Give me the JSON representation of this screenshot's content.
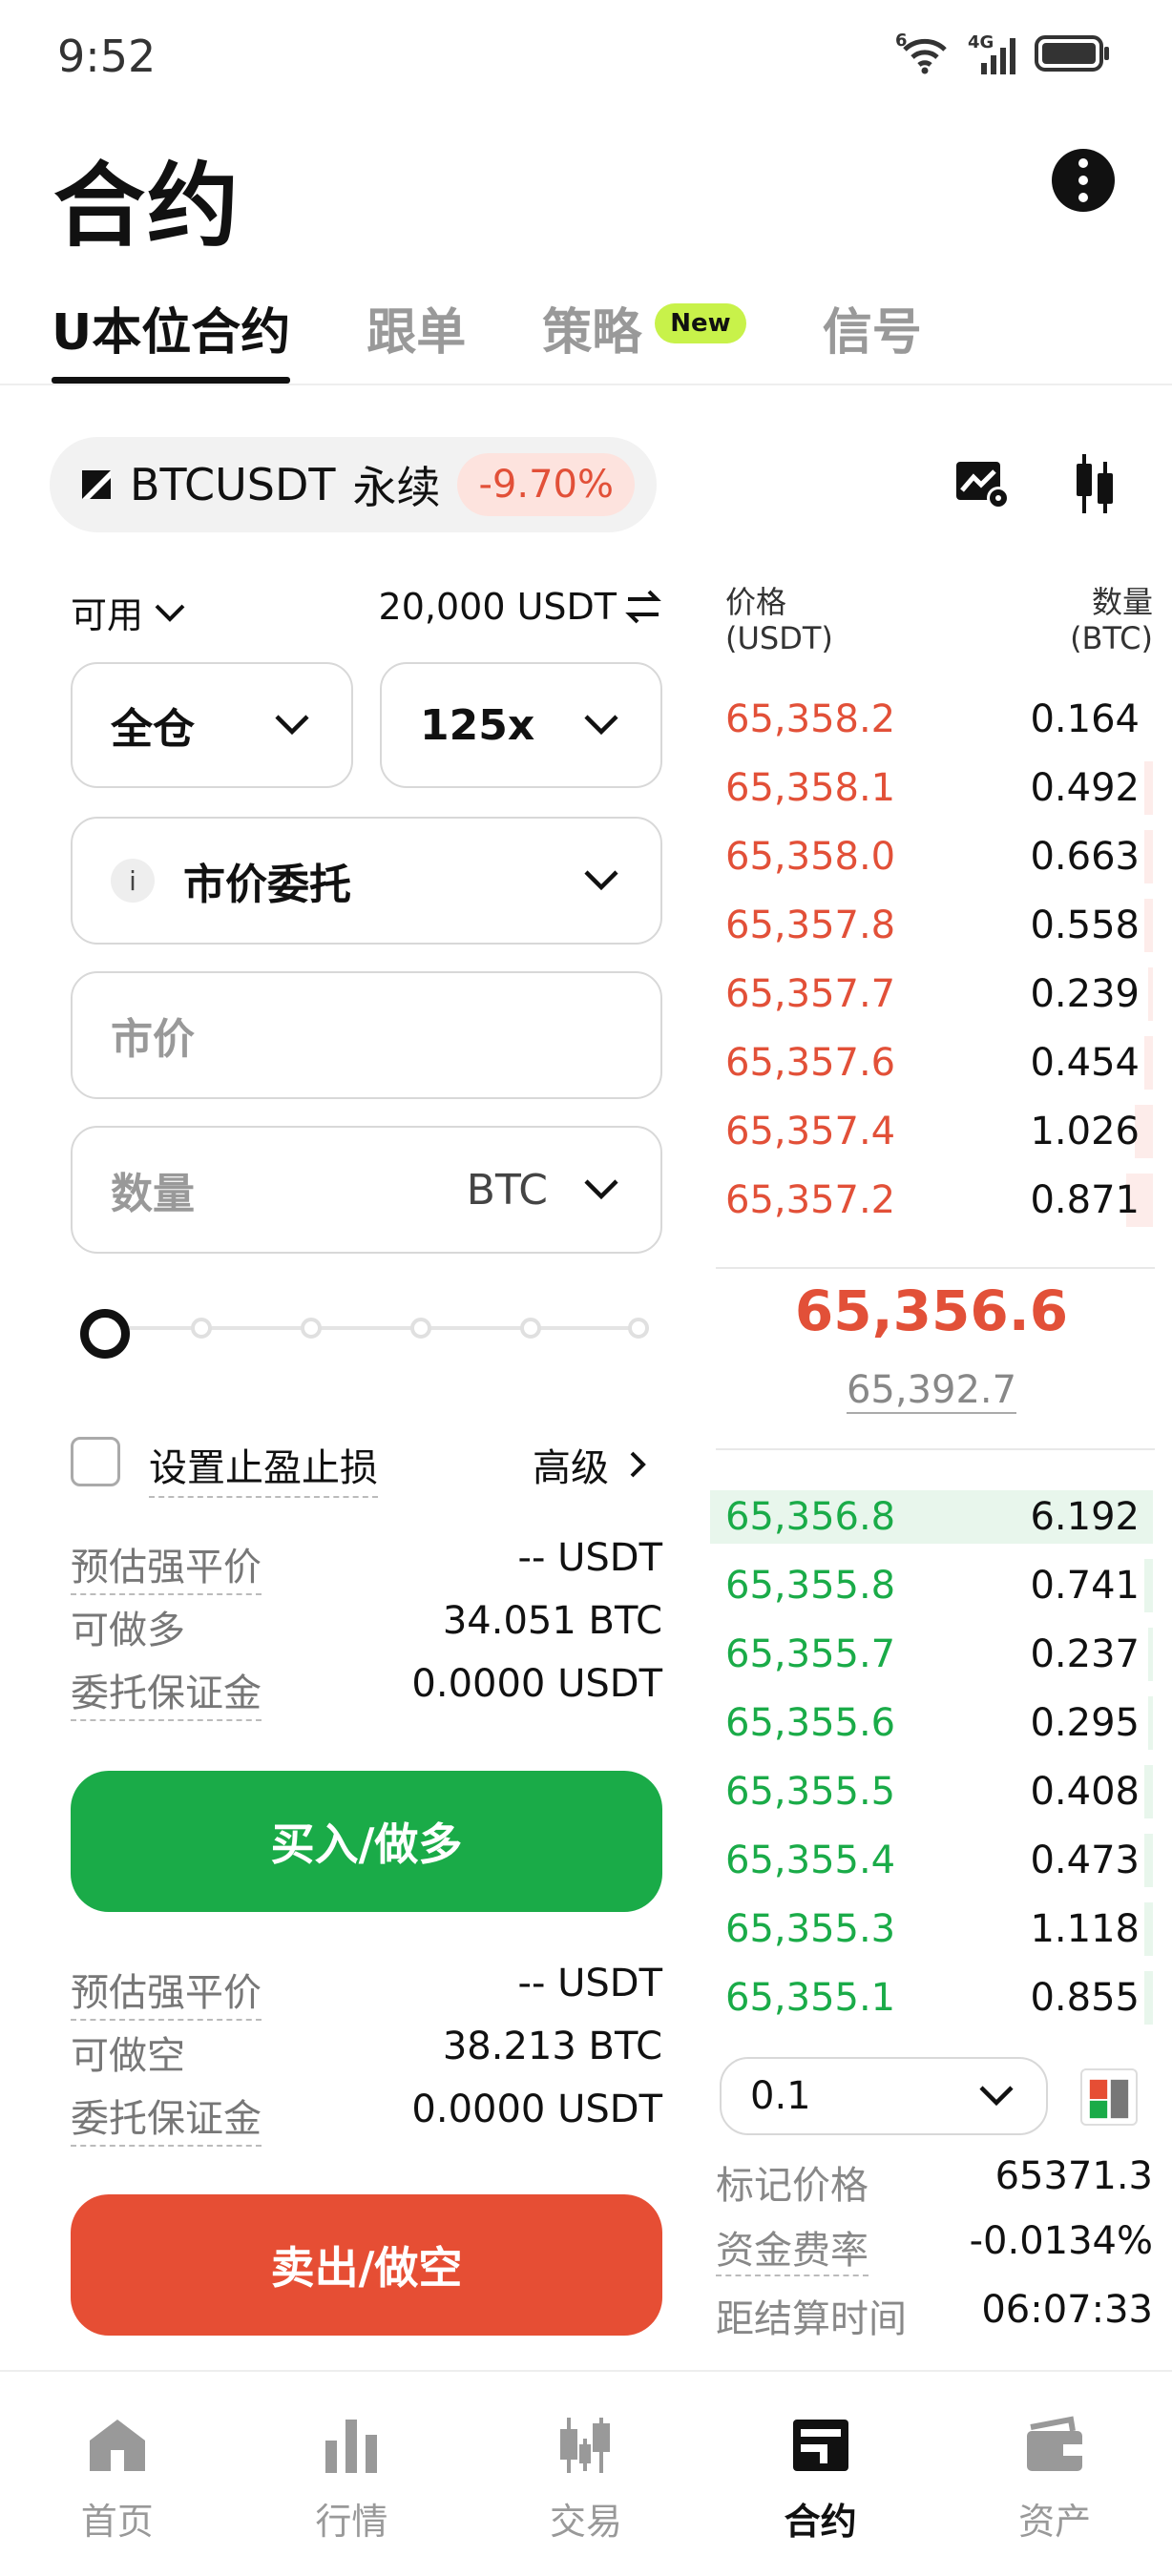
{
  "status_bar": {
    "time": "9:52",
    "wifi_label": "6",
    "network_label": "4G"
  },
  "header": {
    "title": "合约"
  },
  "tabs": [
    {
      "label": "U本位合约",
      "active": true
    },
    {
      "label": "跟单"
    },
    {
      "label": "策略",
      "badge": "New"
    },
    {
      "label": "信号"
    }
  ],
  "symbol": {
    "name": "BTCUSDT",
    "type": "永续",
    "change": "-9.70%"
  },
  "form": {
    "available_label": "可用",
    "available_value": "20,000 USDT",
    "margin_mode": "全仓",
    "leverage": "125x",
    "order_type": "市价委托",
    "info_glyph": "i",
    "price_placeholder": "市价",
    "quantity_placeholder": "数量",
    "quantity_unit": "BTC",
    "slider_percent": 0,
    "tpsl_label": "设置止盈止损",
    "advanced_label": "高级"
  },
  "buy_panel": {
    "rows": [
      {
        "label": "预估强平价",
        "value": "-- USDT"
      },
      {
        "label": "可做多",
        "value": "34.051 BTC"
      },
      {
        "label": "委托保证金",
        "value": "0.0000 USDT"
      }
    ],
    "button": "买入/做多"
  },
  "sell_panel": {
    "rows": [
      {
        "label": "预估强平价",
        "value": "-- USDT"
      },
      {
        "label": "可做空",
        "value": "38.213 BTC"
      },
      {
        "label": "委托保证金",
        "value": "0.0000 USDT"
      }
    ],
    "button": "卖出/做空"
  },
  "orderbook": {
    "price_header": "价格",
    "price_unit": "(USDT)",
    "qty_header": "数量",
    "qty_unit": "(BTC)",
    "asks": [
      {
        "price": "65,358.2",
        "qty": "0.164",
        "depth": 0.0
      },
      {
        "price": "65,358.1",
        "qty": "0.492",
        "depth": 0.02
      },
      {
        "price": "65,358.0",
        "qty": "0.663",
        "depth": 0.02
      },
      {
        "price": "65,357.8",
        "qty": "0.558",
        "depth": 0.02
      },
      {
        "price": "65,357.7",
        "qty": "0.239",
        "depth": 0.01
      },
      {
        "price": "65,357.6",
        "qty": "0.454",
        "depth": 0.02
      },
      {
        "price": "65,357.4",
        "qty": "1.026",
        "depth": 0.04
      },
      {
        "price": "65,357.2",
        "qty": "0.871",
        "depth": 0.06
      }
    ],
    "last_price": "65,356.6",
    "mark_price": "65,392.7",
    "bids": [
      {
        "price": "65,356.8",
        "qty": "6.192",
        "depth": 1.0
      },
      {
        "price": "65,355.8",
        "qty": "0.741",
        "depth": 0.02
      },
      {
        "price": "65,355.7",
        "qty": "0.237",
        "depth": 0.01
      },
      {
        "price": "65,355.6",
        "qty": "0.295",
        "depth": 0.01
      },
      {
        "price": "65,355.5",
        "qty": "0.408",
        "depth": 0.02
      },
      {
        "price": "65,355.4",
        "qty": "0.473",
        "depth": 0.02
      },
      {
        "price": "65,355.3",
        "qty": "1.118",
        "depth": 0.02
      },
      {
        "price": "65,355.1",
        "qty": "0.855",
        "depth": 0.02
      }
    ],
    "depth_step": "0.1"
  },
  "stats": [
    {
      "label": "标记价格",
      "value": "65371.3"
    },
    {
      "label": "资金费率",
      "value": "-0.0134%"
    },
    {
      "label": "距结算时间",
      "value": "06:07:33"
    }
  ],
  "nav": [
    {
      "label": "首页",
      "icon": "home-icon"
    },
    {
      "label": "行情",
      "icon": "chart-bars-icon"
    },
    {
      "label": "交易",
      "icon": "candles-icon"
    },
    {
      "label": "合约",
      "icon": "contract-icon",
      "active": true
    },
    {
      "label": "资产",
      "icon": "wallet-icon"
    }
  ],
  "colors": {
    "buy": "#1aab48",
    "sell": "#e64e34",
    "ask_text": "#e25038",
    "new_badge": "#c8f24a"
  }
}
